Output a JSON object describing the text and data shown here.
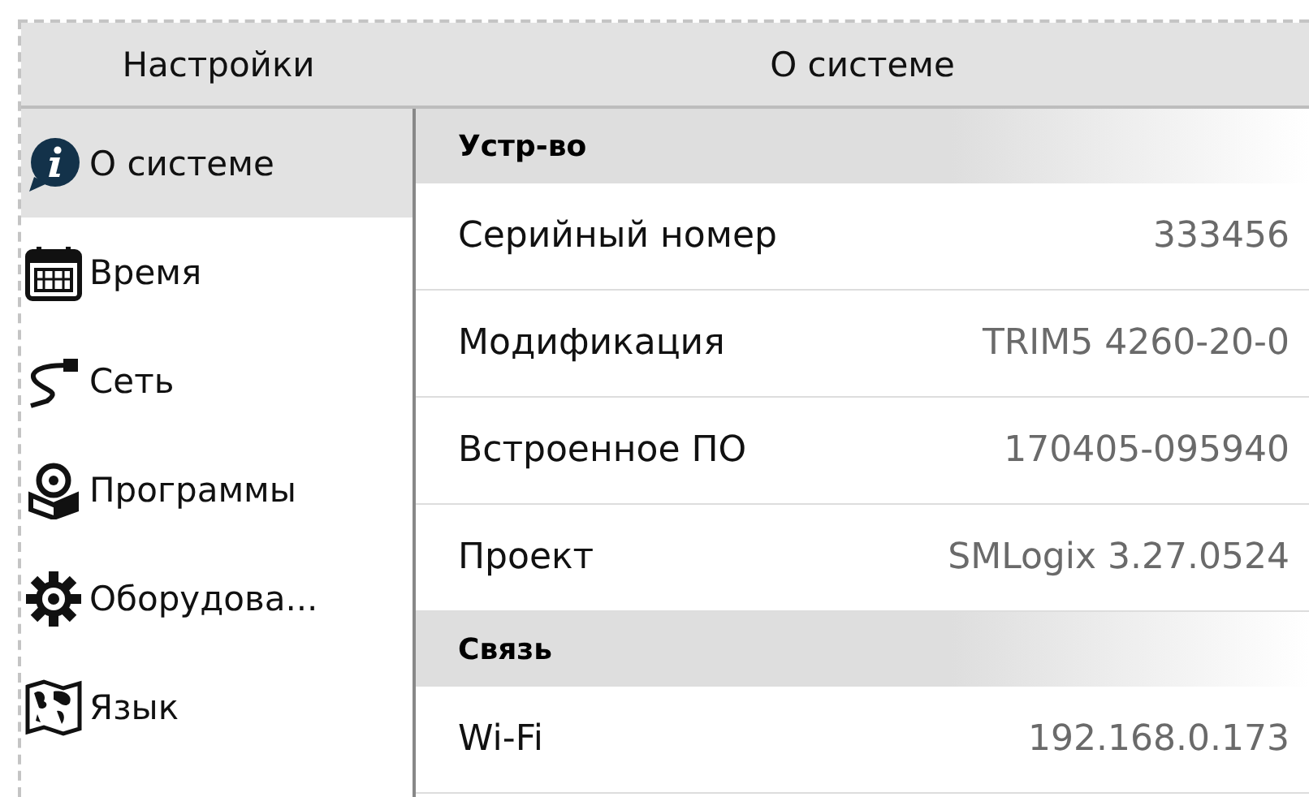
{
  "sidebar": {
    "title": "Настройки",
    "items": [
      {
        "label": "О системе",
        "selected": true
      },
      {
        "label": "Время",
        "selected": false
      },
      {
        "label": "Сеть",
        "selected": false
      },
      {
        "label": "Программы",
        "selected": false
      },
      {
        "label": "Оборудова...",
        "selected": false
      },
      {
        "label": "Язык",
        "selected": false
      }
    ]
  },
  "panel": {
    "title": "О системе",
    "rows": [
      {
        "kind": "section",
        "label": "Устр-во"
      },
      {
        "kind": "field",
        "label": "Серийный номер",
        "value": "333456"
      },
      {
        "kind": "field",
        "label": "Модификация",
        "value": "TRIM5 4260-20-0"
      },
      {
        "kind": "field",
        "label": "Встроенное ПО",
        "value": "170405-095940"
      },
      {
        "kind": "field",
        "label": "Проект",
        "value": "SMLogix 3.27.0524"
      },
      {
        "kind": "section",
        "label": "Связь"
      },
      {
        "kind": "field",
        "label": "Wi-Fi",
        "value": "192.168.0.173"
      }
    ]
  }
}
